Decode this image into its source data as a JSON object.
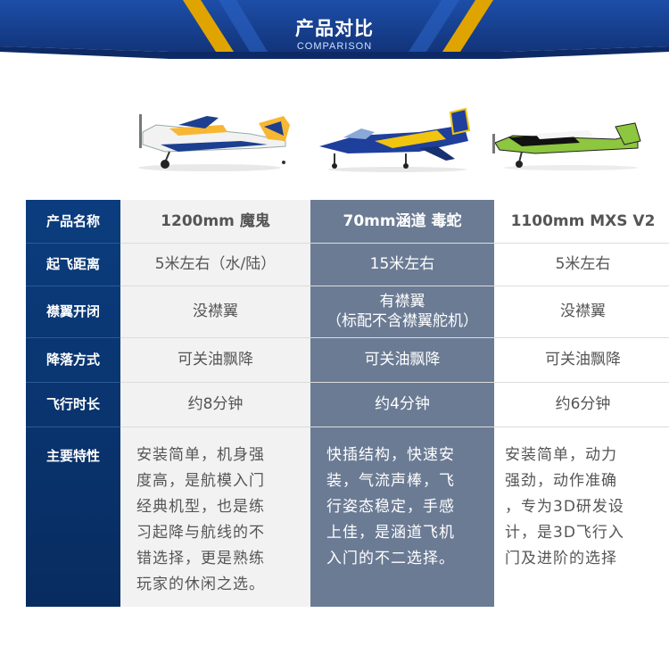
{
  "header": {
    "title": "产品对比",
    "subtitle": "COMPARISON"
  },
  "products": [
    {
      "name": "1200mm 魔鬼"
    },
    {
      "name": "70mm涵道 毒蛇"
    },
    {
      "name": "1100mm  MXS V2"
    }
  ],
  "rows": [
    {
      "label": "产品名称"
    },
    {
      "label": "起飞距离",
      "values": [
        "5米左右（水/陆）",
        "15米左右",
        "5米左右"
      ]
    },
    {
      "label": "襟翼开闭",
      "values": [
        "没襟翼",
        "有襟翼",
        "没襟翼"
      ],
      "note": "（标配不含襟翼舵机）"
    },
    {
      "label": "降落方式",
      "values": [
        "可关油飘降",
        "可关油飘降",
        "可关油飘降"
      ]
    },
    {
      "label": "飞行时长",
      "values": [
        "约8分钟",
        "约4分钟",
        "约6分钟"
      ]
    },
    {
      "label": "主要特性"
    }
  ],
  "features": [
    [
      "安装简单，机身强",
      "度高，是航模入门",
      "经典机型，也是练",
      "习起降与航线的不",
      "错选择，更是熟练",
      "玩家的休闲之选。"
    ],
    [
      "快插结构，快速安",
      "装，气流声棒，飞",
      "行姿态稳定，手感",
      "上佳，是涵道飞机",
      "入门的不二选择。"
    ],
    [
      "安装简单，动力",
      "强劲，动作准确",
      "，专为3D研发设",
      "计，是3D飞行入",
      "门及进阶的选择"
    ]
  ],
  "colors": {
    "banner": "#1a4596",
    "label_column": "#0b3d7e",
    "highlight_column": "#6b7b94",
    "stripe_gold": "#e0a400"
  },
  "icons": [
    "plane-1200mm-icon",
    "jet-70mm-icon",
    "plane-mxs-icon"
  ]
}
